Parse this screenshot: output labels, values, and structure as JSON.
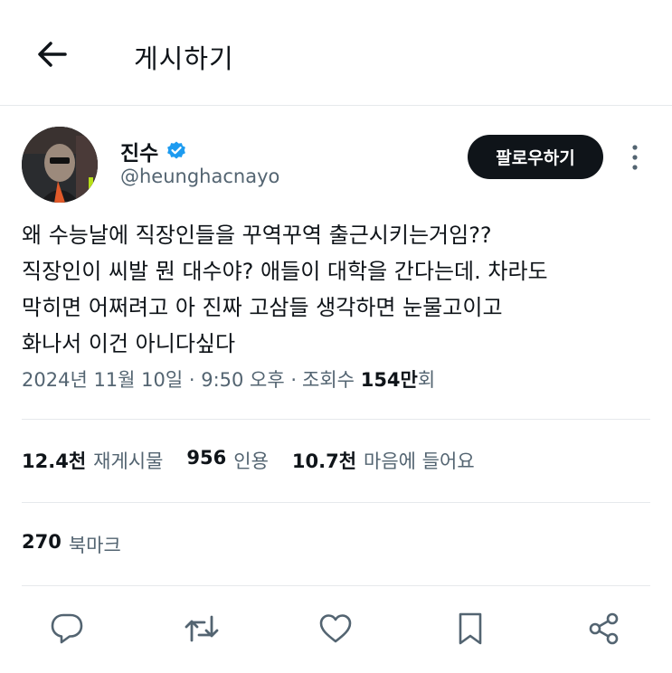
{
  "header": {
    "title": "게시하기"
  },
  "author": {
    "name": "진수",
    "handle": "@heunghacnayo"
  },
  "follow_button": "팔로우하기",
  "tweet": {
    "text": "왜 수능날에 직장인들을 꾸역꾸역 출근시키는거임??\n직장인이 씨발 뭔 대수야? 애들이 대학을 간다는데. 차라도\n막히면 어쩌려고 아 진짜 고삼들 생각하면 눈물고이고\n화나서 이건 아니다싶다"
  },
  "meta": {
    "datetime": "2024년 11월 10일 · 9:50 오후 ·",
    "views_label": "조회수",
    "views_count": "154만",
    "views_suffix": "회"
  },
  "stats": {
    "reposts": {
      "count": "12.4천",
      "label": "재게시물"
    },
    "quotes": {
      "count": "956",
      "label": "인용"
    },
    "likes": {
      "count": "10.7천",
      "label": "마음에 들어요"
    },
    "bookmarks": {
      "count": "270",
      "label": "북마크"
    }
  },
  "icons": {
    "back": "arrow-left-icon",
    "verified": "verified-badge-icon",
    "more": "more-vertical-icon",
    "reply": "reply-icon",
    "repost": "repost-icon",
    "like": "heart-icon",
    "bookmark": "bookmark-icon",
    "share": "share-icon"
  },
  "colors": {
    "verified": "#1d9bf0",
    "text_secondary": "#536471",
    "follow_bg": "#0f1419"
  }
}
